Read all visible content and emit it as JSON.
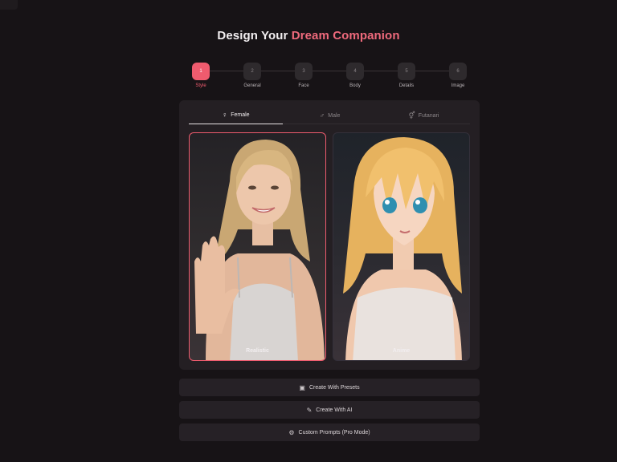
{
  "header": {
    "title_part1": "Design Your",
    "title_part2": "Dream Companion"
  },
  "stepper": {
    "steps": [
      {
        "number": "1",
        "label": "Style",
        "active": true
      },
      {
        "number": "2",
        "label": "General",
        "active": false
      },
      {
        "number": "3",
        "label": "Face",
        "active": false
      },
      {
        "number": "4",
        "label": "Body",
        "active": false
      },
      {
        "number": "5",
        "label": "Details",
        "active": false
      },
      {
        "number": "6",
        "label": "Image",
        "active": false
      }
    ]
  },
  "gender_tabs": [
    {
      "label": "Female",
      "icon": "female-icon",
      "active": true
    },
    {
      "label": "Male",
      "icon": "male-icon",
      "active": false
    },
    {
      "label": "Futanari",
      "icon": "futanari-icon",
      "active": false
    }
  ],
  "style_options": [
    {
      "label": "Realistic",
      "selected": true
    },
    {
      "label": "Anime",
      "selected": false
    }
  ],
  "actions": [
    {
      "label": "Create With Presets",
      "icon": "image-icon"
    },
    {
      "label": "Create With AI",
      "icon": "magic-wand-icon"
    },
    {
      "label": "Custom Prompts (Pro Mode)",
      "icon": "gear-icon"
    }
  ],
  "colors": {
    "accent": "#ef5b6e",
    "background": "#171316",
    "card": "#241f23"
  }
}
